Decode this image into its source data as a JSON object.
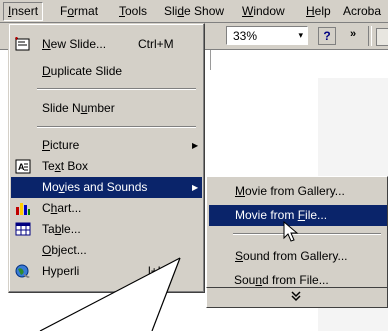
{
  "menubar": {
    "items": [
      {
        "label": "Insert",
        "key": "I",
        "pre": "",
        "post": "nsert"
      },
      {
        "label": "Format",
        "key": "o",
        "pre": "F",
        "post": "rmat"
      },
      {
        "label": "Tools",
        "key": "T",
        "pre": "",
        "post": "ools"
      },
      {
        "label": "Slide Show",
        "key": "d",
        "pre": "Sli",
        "post": "e Show"
      },
      {
        "label": "Window",
        "key": "W",
        "pre": "",
        "post": "indow"
      },
      {
        "label": "Help",
        "key": "H",
        "pre": "",
        "post": "elp"
      },
      {
        "label": "Acroba",
        "key": "",
        "pre": "Acroba",
        "post": ""
      }
    ]
  },
  "toolbar": {
    "zoom_value": "33%",
    "zoom_arrow": "▾",
    "help_glyph": "?",
    "more_glyph": "»"
  },
  "insert_menu": {
    "new_slide": {
      "pre": "",
      "key": "N",
      "post": "ew Slide...",
      "shortcut": "Ctrl+M"
    },
    "duplicate_slide": {
      "pre": "",
      "key": "D",
      "post": "uplicate Slide"
    },
    "slide_number": {
      "pre": "Slide N",
      "key": "u",
      "post": "mber"
    },
    "picture": {
      "pre": "",
      "key": "P",
      "post": "icture"
    },
    "text_box": {
      "pre": "Te",
      "key": "x",
      "post": "t Box"
    },
    "movies_sounds": {
      "pre": "Mo",
      "key": "v",
      "post": "ies and Sounds"
    },
    "chart": {
      "pre": "C",
      "key": "h",
      "post": "art..."
    },
    "table": {
      "pre": "Ta",
      "key": "b",
      "post": "le..."
    },
    "object": {
      "pre": "",
      "key": "O",
      "post": "bject..."
    },
    "hyperlink": {
      "pre": "Hyperli",
      "key": "",
      "post": "",
      "shortcut": "l+K"
    },
    "arrow_glyph": "▶"
  },
  "sub_menu": {
    "movie_gallery": {
      "pre": "",
      "key": "M",
      "post": "ovie from Gallery..."
    },
    "movie_file": {
      "pre": "Movie from ",
      "key": "F",
      "post": "ile..."
    },
    "sound_gallery": {
      "pre": "",
      "key": "S",
      "post": "ound from Gallery..."
    },
    "sound_file": {
      "pre": "Sou",
      "key": "n",
      "post": "d from File..."
    },
    "more_glyph": "¥"
  },
  "colors": {
    "highlight": "#0a246a",
    "face": "#d4d0c8",
    "shadow": "#808080"
  }
}
